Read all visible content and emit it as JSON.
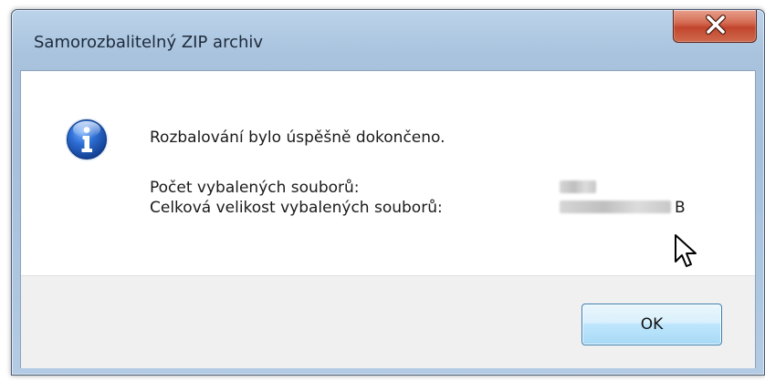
{
  "window": {
    "title": "Samorozbalitelný ZIP archiv",
    "close_icon": "close-icon"
  },
  "message": {
    "icon": "info-icon",
    "text": "Rozbalování bylo úspěšně dokončeno.",
    "count_label": "Počet vybalených souborů:",
    "size_label": "Celková velikost vybalených souborů:",
    "size_unit": "B"
  },
  "buttons": {
    "ok_label": "OK"
  },
  "colors": {
    "frame": "#a9c3de",
    "close_red": "#c2452c",
    "button_blue": "#bee6fd",
    "footer_gray": "#f0f0f0"
  }
}
